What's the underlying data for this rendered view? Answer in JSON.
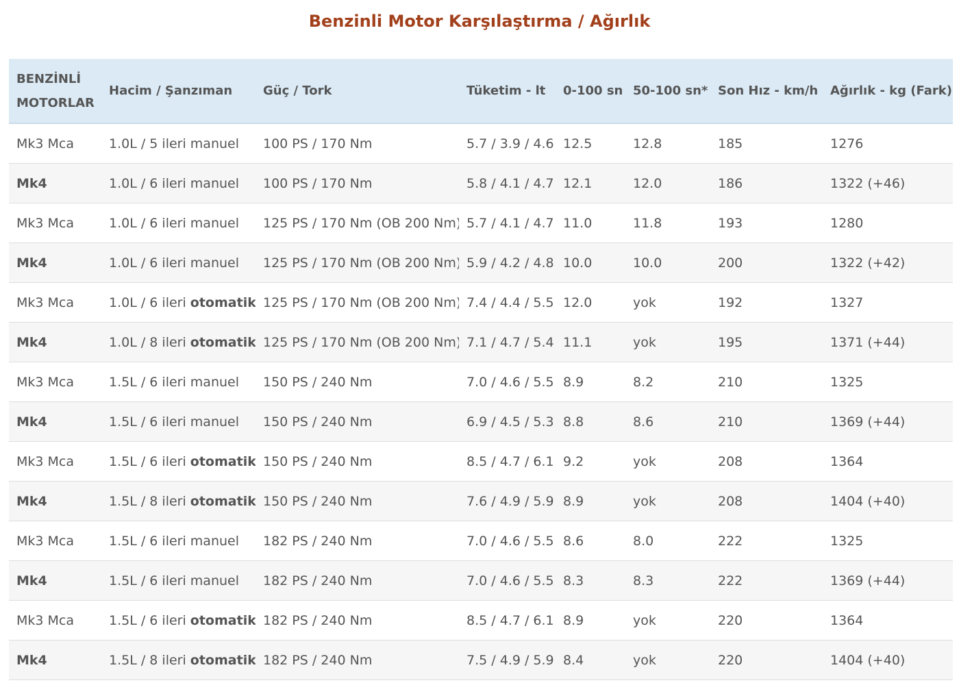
{
  "title": "Benzinli Motor Karşılaştırma / Ağırlık",
  "table": {
    "headers": {
      "col1_line1": "BENZİNLİ",
      "col1_line2": "MOTORLAR",
      "col2": "Hacim / Şanzıman",
      "col3": "Güç / Tork",
      "col4": "Tüketim - lt",
      "col5": "0-100 sn",
      "col6": "50-100 sn*",
      "col7": "Son Hız - km/h",
      "col8": "Ağırlık - kg (Fark)"
    },
    "rows": [
      {
        "model": "Mk3 Mca",
        "trans_prefix": "1.0L / 5 ileri ",
        "trans_type": "manuel",
        "power": "100 PS / 170 Nm",
        "consumption": "5.7 / 3.9 / 4.6",
        "acc0100": "12.5",
        "acc50100": "12.8",
        "top_speed": "185",
        "weight": "1276"
      },
      {
        "model": "Mk4",
        "trans_prefix": "1.0L / 6 ileri ",
        "trans_type": "manuel",
        "power": "100 PS / 170 Nm",
        "consumption": "5.8 / 4.1 / 4.7",
        "acc0100": "12.1",
        "acc50100": "12.0",
        "top_speed": "186",
        "weight": "1322 (+46)"
      },
      {
        "model": "Mk3 Mca",
        "trans_prefix": "1.0L / 6 ileri ",
        "trans_type": "manuel",
        "power": "125 PS / 170 Nm (OB 200 Nm)",
        "consumption": "5.7 / 4.1 / 4.7",
        "acc0100": "11.0",
        "acc50100": "11.8",
        "top_speed": "193",
        "weight": "1280"
      },
      {
        "model": "Mk4",
        "trans_prefix": "1.0L / 6 ileri ",
        "trans_type": "manuel",
        "power": "125 PS / 170 Nm (OB 200 Nm)",
        "consumption": "5.9 / 4.2 / 4.8",
        "acc0100": "10.0",
        "acc50100": "10.0",
        "top_speed": "200",
        "weight": "1322 (+42)"
      },
      {
        "model": "Mk3 Mca",
        "trans_prefix": "1.0L / 6 ileri ",
        "trans_type": "otomatik",
        "power": "125 PS / 170 Nm (OB 200 Nm)",
        "consumption": "7.4 / 4.4 / 5.5",
        "acc0100": "12.0",
        "acc50100": "yok",
        "top_speed": "192",
        "weight": "1327"
      },
      {
        "model": "Mk4",
        "trans_prefix": "1.0L / 8 ileri ",
        "trans_type": "otomatik",
        "power": "125 PS / 170 Nm (OB 200 Nm)",
        "consumption": "7.1 / 4.7 / 5.4",
        "acc0100": "11.1",
        "acc50100": "yok",
        "top_speed": "195",
        "weight": "1371 (+44)"
      },
      {
        "model": "Mk3 Mca",
        "trans_prefix": "1.5L / 6 ileri ",
        "trans_type": "manuel",
        "power": "150 PS / 240 Nm",
        "consumption": "7.0 / 4.6 / 5.5",
        "acc0100": "8.9",
        "acc50100": "8.2",
        "top_speed": "210",
        "weight": "1325"
      },
      {
        "model": "Mk4",
        "trans_prefix": "1.5L / 6 ileri ",
        "trans_type": "manuel",
        "power": "150 PS / 240 Nm",
        "consumption": "6.9 / 4.5 / 5.3",
        "acc0100": "8.8",
        "acc50100": "8.6",
        "top_speed": "210",
        "weight": "1369 (+44)"
      },
      {
        "model": "Mk3 Mca",
        "trans_prefix": "1.5L / 6 ileri ",
        "trans_type": "otomatik",
        "power": "150 PS / 240 Nm",
        "consumption": "8.5 / 4.7 / 6.1",
        "acc0100": "9.2",
        "acc50100": "yok",
        "top_speed": "208",
        "weight": "1364"
      },
      {
        "model": "Mk4",
        "trans_prefix": "1.5L / 8 ileri ",
        "trans_type": "otomatik",
        "power": "150 PS / 240 Nm",
        "consumption": "7.6 / 4.9 / 5.9",
        "acc0100": "8.9",
        "acc50100": "yok",
        "top_speed": "208",
        "weight": "1404 (+40)"
      },
      {
        "model": "Mk3 Mca",
        "trans_prefix": "1.5L / 6 ileri ",
        "trans_type": "manuel",
        "power": "182 PS / 240 Nm",
        "consumption": "7.0 / 4.6 / 5.5",
        "acc0100": "8.6",
        "acc50100": "8.0",
        "top_speed": "222",
        "weight": "1325"
      },
      {
        "model": "Mk4",
        "trans_prefix": "1.5L / 6 ileri ",
        "trans_type": "manuel",
        "power": "182 PS / 240 Nm",
        "consumption": "7.0 / 4.6 / 5.5",
        "acc0100": "8.3",
        "acc50100": "8.3",
        "top_speed": "222",
        "weight": "1369 (+44)"
      },
      {
        "model": "Mk3 Mca",
        "trans_prefix": "1.5L / 6 ileri ",
        "trans_type": "otomatik",
        "power": "182 PS / 240 Nm",
        "consumption": "8.5 / 4.7 / 6.1",
        "acc0100": "8.9",
        "acc50100": "yok",
        "top_speed": "220",
        "weight": "1364"
      },
      {
        "model": "Mk4",
        "trans_prefix": "1.5L / 8 ileri ",
        "trans_type": "otomatik",
        "power": "182 PS / 240 Nm",
        "consumption": "7.5 / 4.9 / 5.9",
        "acc0100": "8.4",
        "acc50100": "yok",
        "top_speed": "220",
        "weight": "1404 (+40)"
      }
    ]
  },
  "colors": {
    "title": "#a2401c",
    "header_bg": "#dbeaf5",
    "stripe_bg": "#f6f6f6",
    "text": "#555555"
  }
}
